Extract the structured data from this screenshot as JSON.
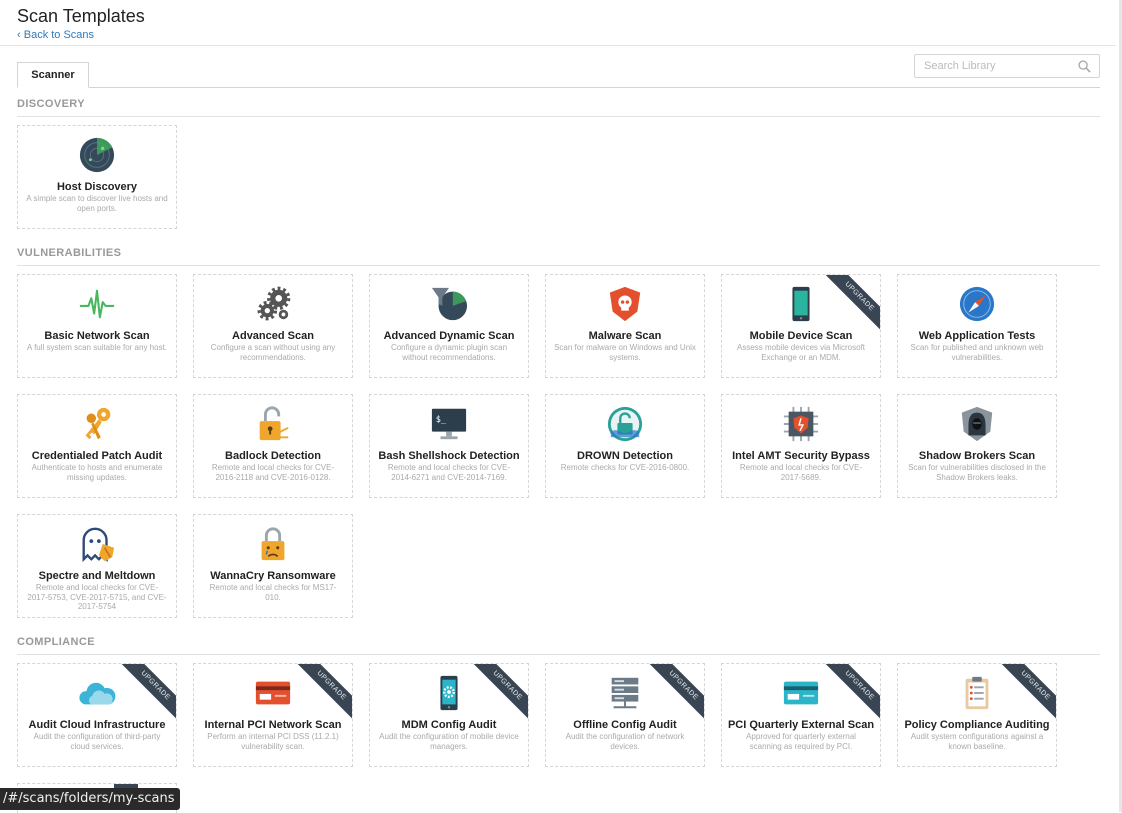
{
  "header": {
    "title": "Scan Templates",
    "back_link": "Back to Scans"
  },
  "tabs": [
    {
      "label": "Scanner",
      "active": true
    }
  ],
  "search": {
    "placeholder": "Search Library"
  },
  "sections": {
    "discovery": "DISCOVERY",
    "vulnerabilities": "VULNERABILITIES",
    "compliance": "COMPLIANCE"
  },
  "ribbon_label": "UPGRADE",
  "cards": {
    "host_discovery": {
      "name": "Host Discovery",
      "desc": "A simple scan to discover live hosts and open ports.",
      "icon": "radar-icon"
    },
    "basic_network": {
      "name": "Basic Network Scan",
      "desc": "A full system scan suitable for any host.",
      "icon": "pulse-icon"
    },
    "advanced": {
      "name": "Advanced Scan",
      "desc": "Configure a scan without using any recommendations.",
      "icon": "gears-icon"
    },
    "advanced_dynamic": {
      "name": "Advanced Dynamic Scan",
      "desc": "Configure a dynamic plugin scan without recommendations.",
      "icon": "filter-radar-icon"
    },
    "malware": {
      "name": "Malware Scan",
      "desc": "Scan for malware on Windows and Unix systems.",
      "icon": "skull-shield-icon"
    },
    "mobile_device": {
      "name": "Mobile Device Scan",
      "desc": "Assess mobile devices via Microsoft Exchange or an MDM.",
      "icon": "phone-icon",
      "upgrade": true
    },
    "web_app": {
      "name": "Web Application Tests",
      "desc": "Scan for published and unknown web vulnerabilities.",
      "icon": "compass-icon"
    },
    "credentialed_patch": {
      "name": "Credentialed Patch Audit",
      "desc": "Authenticate to hosts and enumerate missing updates.",
      "icon": "keys-icon"
    },
    "badlock": {
      "name": "Badlock Detection",
      "desc": "Remote and local checks for CVE-2016-2118 and CVE-2016-0128.",
      "icon": "open-lock-icon"
    },
    "bash_shellshock": {
      "name": "Bash Shellshock Detection",
      "desc": "Remote and local checks for CVE-2014-6271 and CVE-2014-7169.",
      "icon": "terminal-icon"
    },
    "drown": {
      "name": "DROWN Detection",
      "desc": "Remote checks for CVE-2016-0800.",
      "icon": "drown-lock-icon"
    },
    "intel_amt": {
      "name": "Intel AMT Security Bypass",
      "desc": "Remote and local checks for CVE-2017-5689.",
      "icon": "chip-icon"
    },
    "shadow_brokers": {
      "name": "Shadow Brokers Scan",
      "desc": "Scan for vulnerabilities disclosed in the Shadow Brokers leaks.",
      "icon": "hooded-figure-icon"
    },
    "spectre_meltdown": {
      "name": "Spectre and Meltdown",
      "desc": "Remote and local checks for CVE-2017-5753, CVE-2017-5715, and CVE-2017-5754",
      "icon": "ghost-shield-icon"
    },
    "wannacry": {
      "name": "WannaCry Ransomware",
      "desc": "Remote and local checks for MS17-010.",
      "icon": "crying-lock-icon"
    },
    "audit_cloud": {
      "name": "Audit Cloud Infrastructure",
      "desc": "Audit the configuration of third-party cloud services.",
      "icon": "cloud-icon",
      "upgrade": true
    },
    "internal_pci": {
      "name": "Internal PCI Network Scan",
      "desc": "Perform an internal PCI DSS (11.2.1) vulnerability scan.",
      "icon": "card-icon",
      "upgrade": true
    },
    "mdm_config": {
      "name": "MDM Config Audit",
      "desc": "Audit the configuration of mobile device managers.",
      "icon": "phone-gear-icon",
      "upgrade": true
    },
    "offline_config": {
      "name": "Offline Config Audit",
      "desc": "Audit the configuration of network devices.",
      "icon": "server-stack-icon",
      "upgrade": true
    },
    "pci_quarterly": {
      "name": "PCI Quarterly External Scan",
      "desc": "Approved for quarterly external scanning as required by PCI.",
      "icon": "credit-card-icon",
      "upgrade": true
    },
    "policy_compliance": {
      "name": "Policy Compliance Auditing",
      "desc": "Audit system configurations against a known baseline.",
      "icon": "clipboard-icon",
      "upgrade": true
    }
  },
  "status_bar": {
    "url": "/#/scans/folders/my-scans"
  },
  "colors": {
    "link": "#2f7ab9",
    "ribbon": "#3a4554",
    "section_title": "#999999"
  }
}
